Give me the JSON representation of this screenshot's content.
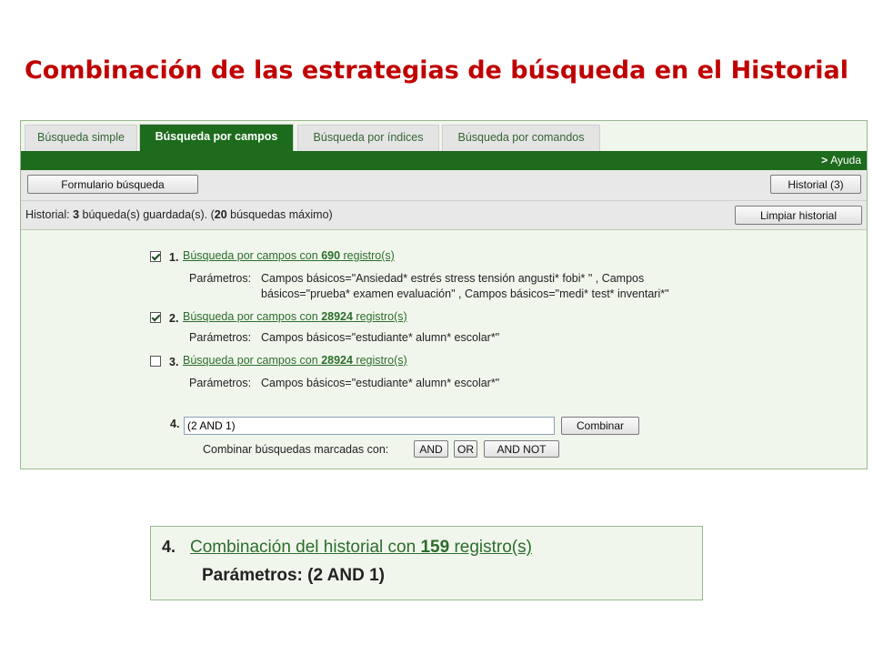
{
  "slide_title": "Combinación de  las estrategias de búsqueda en el Historial",
  "tabs": [
    {
      "label": "Búsqueda simple",
      "active": false
    },
    {
      "label": "Búsqueda por campos",
      "active": true
    },
    {
      "label": "Búsqueda por índices",
      "active": false
    },
    {
      "label": "Búsqueda por comandos",
      "active": false
    }
  ],
  "ayuda": {
    "arrow": ">",
    "label": "Ayuda"
  },
  "toolbar": {
    "form_button": "Formulario búsqueda",
    "history_button": "Historial (3)"
  },
  "history": {
    "prefix": "Historial: ",
    "count": "3",
    "middle": " búqueda(s) guardada(s). (",
    "max": "20",
    "suffix": " búsquedas máximo)",
    "clear_button": "Limpiar historial"
  },
  "entries": [
    {
      "checked": true,
      "number": "1.",
      "link_prefix": "Búsqueda por campos con ",
      "records": "690",
      "link_suffix": " registro(s)",
      "params_label": "Parámetros:",
      "params_line1": "Campos básicos=\"Ansiedad* estrés stress tensión angusti* fobi* \" , Campos",
      "params_line2": "básicos=\"prueba* examen evaluación\" , Campos básicos=\"medi* test* inventari*\""
    },
    {
      "checked": true,
      "number": "2.",
      "link_prefix": "Búsqueda por campos con ",
      "records": "28924",
      "link_suffix": " registro(s)",
      "params_label": "Parámetros:",
      "params_line1": "Campos básicos=\"estudiante* alumn* escolar*\"",
      "params_line2": ""
    },
    {
      "checked": false,
      "number": "3.",
      "link_prefix": "Búsqueda por campos con ",
      "records": "28924",
      "link_suffix": " registro(s)",
      "params_label": "Parámetros:",
      "params_line1": "Campos básicos=\"estudiante* alumn* escolar*\"",
      "params_line2": ""
    }
  ],
  "combine": {
    "number": "4.",
    "input_value": "(2 AND 1)",
    "button": "Combinar",
    "label": "Combinar búsquedas marcadas con:",
    "and": "AND",
    "or": "OR",
    "and_not": "AND NOT"
  },
  "result": {
    "number": "4.",
    "link_prefix": "Combinación del historial con ",
    "records": "159",
    "link_suffix": " registro(s)",
    "params": "Parámetros: (2 AND 1)"
  }
}
